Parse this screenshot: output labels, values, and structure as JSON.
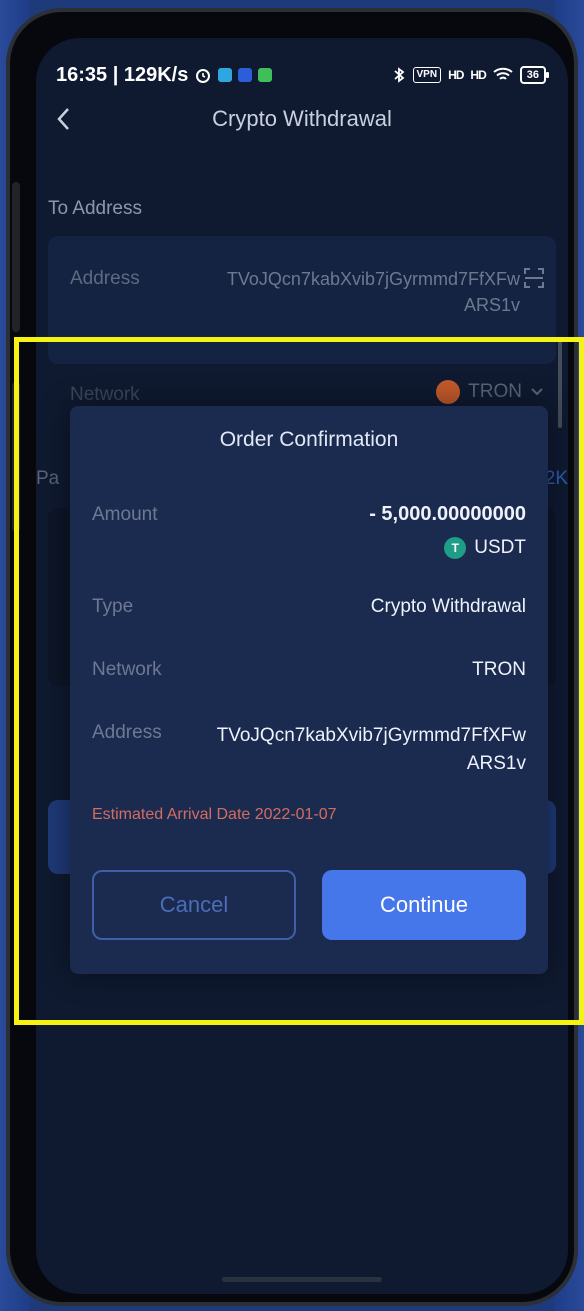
{
  "status_bar": {
    "time_speed": "16:35 | 129K/s",
    "vpn": "VPN",
    "signal_1": "HD",
    "signal_2": "HD",
    "battery": "36"
  },
  "nav": {
    "title": "Crypto Withdrawal"
  },
  "form": {
    "to_address_label": "To Address",
    "address_key": "Address",
    "address_value": "TVoJQcn7kabXvib7jGyrmmd7FfXFw ARS1v",
    "network_key": "Network",
    "network_value": "TRON",
    "partial_left": "Pa",
    "partial_right": "2K"
  },
  "modal": {
    "title": "Order Confirmation",
    "amount_key": "Amount",
    "amount_value": "- 5,000.00000000",
    "currency": "USDT",
    "type_key": "Type",
    "type_value": "Crypto Withdrawal",
    "network_key": "Network",
    "network_value": "TRON",
    "address_key": "Address",
    "address_value": "TVoJQcn7kabXvib7jGyrmmd7FfXFw ARS1v",
    "eta": "Estimated Arrival Date 2022-01-07",
    "cancel_label": "Cancel",
    "continue_label": "Continue"
  },
  "colors": {
    "background": "#0f1a30",
    "modal": "#1b2a4f",
    "primary": "#4677ea",
    "eta": "#d36d62",
    "highlight": "#f5f312"
  },
  "icons": [
    "back-icon",
    "scan-icon",
    "tron-icon",
    "chevron-down-icon",
    "usdt-icon"
  ]
}
